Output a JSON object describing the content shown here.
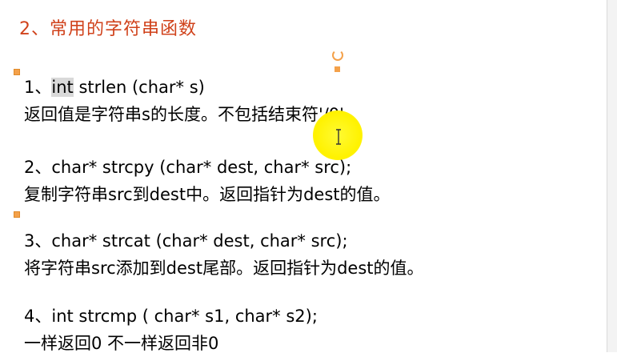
{
  "slide": {
    "heading": "2、常用的字符串函数",
    "items": [
      {
        "sig_prefix": "1、",
        "sig_highlight": "int",
        "sig_rest": " strlen (char* s)",
        "desc": "返回值是字符串s的长度。不包括结束符'/0'。"
      },
      {
        "sig": "2、char* strcpy (char* dest, char* src);",
        "desc": "复制字符串src到dest中。返回指针为dest的值。"
      },
      {
        "sig": "3、char* strcat (char* dest, char* src);",
        "desc": "将字符串src添加到dest尾部。返回指针为dest的值。"
      },
      {
        "sig": "4、int strcmp ( char* s1, char* s2);",
        "desc": "一样返回0  不一样返回非0"
      }
    ]
  },
  "colors": {
    "heading": "#d0421b",
    "selection_handle": "#f4a14a",
    "cursor_highlight": "#fff200",
    "text_highlight": "#d9d9d9"
  },
  "icons": {
    "rotate_handle": "rotate-handle-icon",
    "text_cursor": "i-beam-cursor-icon"
  }
}
